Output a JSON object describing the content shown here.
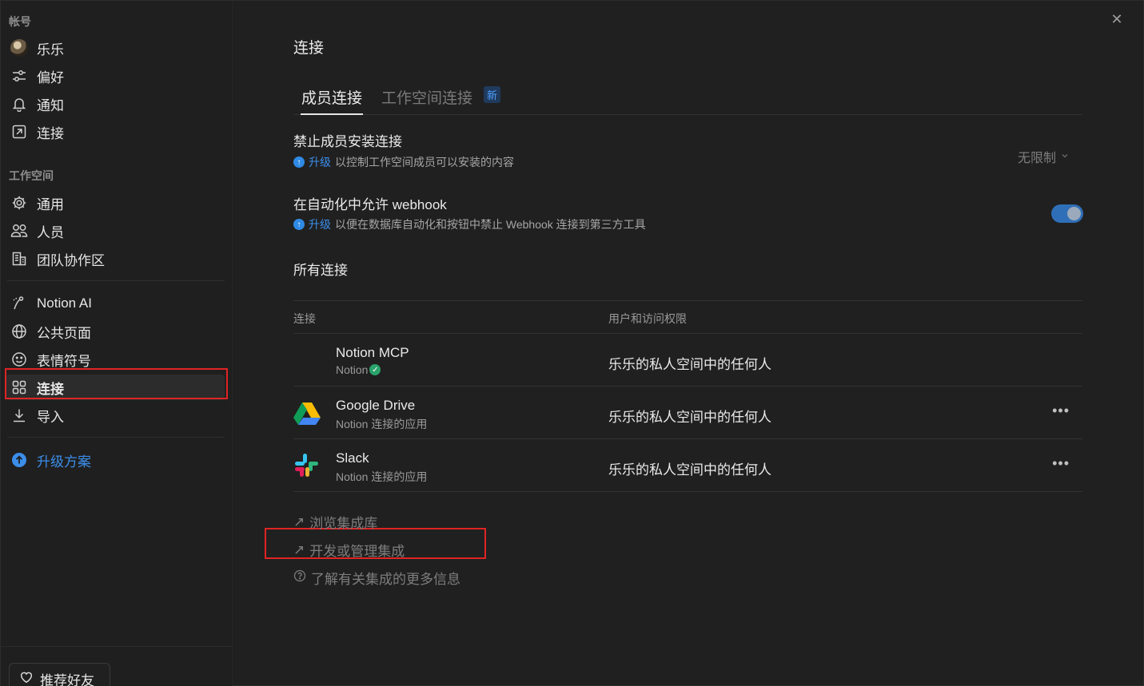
{
  "sidebar": {
    "account_label": "帐号",
    "account_items": [
      {
        "label": "乐乐",
        "icon": "avatar"
      },
      {
        "label": "偏好",
        "icon": "sliders-icon"
      },
      {
        "label": "通知",
        "icon": "bell-icon"
      },
      {
        "label": "连接",
        "icon": "external-link-icon"
      }
    ],
    "workspace_label": "工作空间",
    "workspace_items": [
      {
        "label": "通用",
        "icon": "gear-icon"
      },
      {
        "label": "人员",
        "icon": "people-icon"
      },
      {
        "label": "团队协作区",
        "icon": "building-icon"
      }
    ],
    "feature_items": [
      {
        "label": "Notion AI",
        "icon": "notion-ai-icon"
      },
      {
        "label": "公共页面",
        "icon": "globe-icon"
      },
      {
        "label": "表情符号",
        "icon": "smiley-icon"
      },
      {
        "label": "连接",
        "icon": "grid-icon",
        "active": true
      },
      {
        "label": "导入",
        "icon": "download-icon"
      }
    ],
    "upgrade_label": "升级方案",
    "invite_label": "推荐好友"
  },
  "main": {
    "title": "连接",
    "tabs": [
      {
        "label": "成员连接",
        "active": true
      },
      {
        "label": "工作空间连接",
        "active": false
      }
    ],
    "new_badge": "新",
    "settings": [
      {
        "title": "禁止成员安装连接",
        "upgrade_link": "升级",
        "desc": "以控制工作空间成员可以安装的内容",
        "control_value": "无限制"
      },
      {
        "title": "在自动化中允许 webhook",
        "upgrade_link": "升级",
        "desc": "以便在数据库自动化和按钮中禁止 Webhook 连接到第三方工具",
        "toggle_on": true
      }
    ],
    "all_connections_heading": "所有连接",
    "table": {
      "columns": [
        "连接",
        "用户和访问权限"
      ],
      "rows": [
        {
          "name": "Notion MCP",
          "sub": "Notion",
          "verified": true,
          "access": "乐乐的私人空间中的任何人",
          "logo": "notion-mcp-icon"
        },
        {
          "name": "Google Drive",
          "sub": "Notion 连接的应用",
          "access": "乐乐的私人空间中的任何人",
          "logo": "google-drive-icon"
        },
        {
          "name": "Slack",
          "sub": "Notion 连接的应用",
          "access": "乐乐的私人空间中的任何人",
          "logo": "slack-icon"
        }
      ]
    },
    "footer_links": [
      {
        "label": "浏览集成库",
        "icon": "arrow-up-right-icon"
      },
      {
        "label": "开发或管理集成",
        "icon": "arrow-up-right-icon"
      },
      {
        "label": "了解有关集成的更多信息",
        "icon": "help-circle-icon"
      }
    ]
  },
  "colors": {
    "accent": "#3b8eea",
    "highlight_box": "#e02424",
    "background": "#202020"
  }
}
